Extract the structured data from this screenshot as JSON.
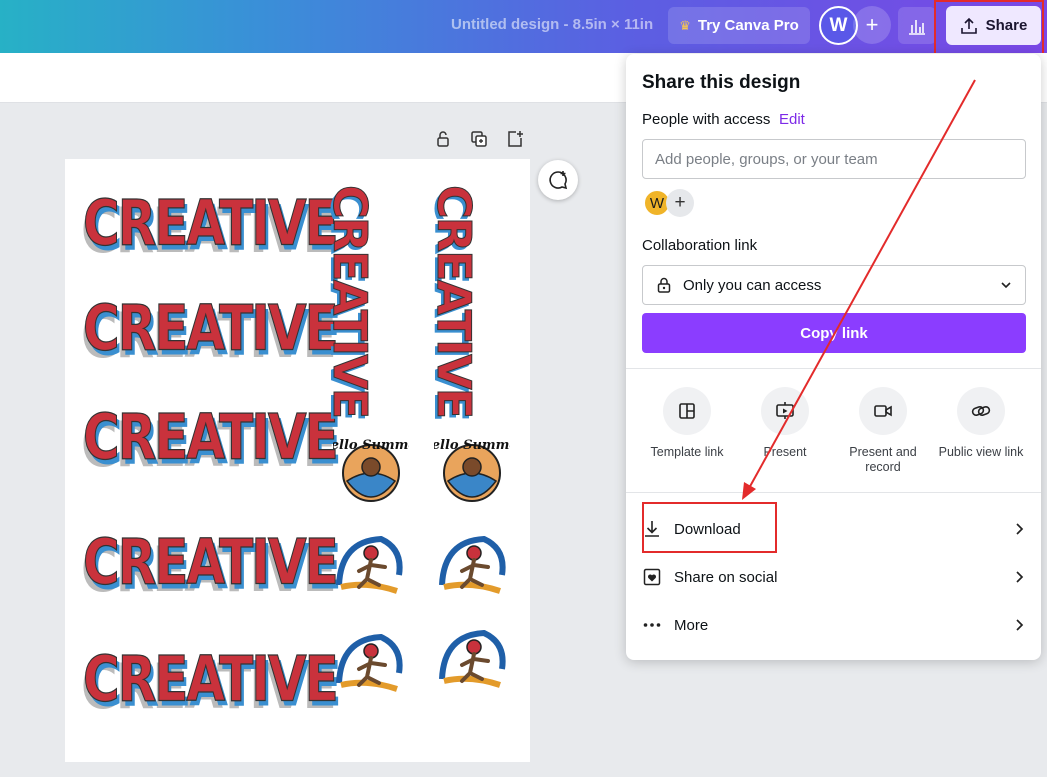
{
  "topbar": {
    "doc_title": "Untitled design - 8.5in × 11in",
    "try_pro_label": "Try Canva Pro",
    "user_initial": "W",
    "share_label": "Share"
  },
  "canvas": {
    "artwork_text": "CREATIVE",
    "sticker_text": "Hello Summer"
  },
  "share_panel": {
    "title": "Share this design",
    "people_label": "People with access",
    "edit_label": "Edit",
    "add_people_placeholder": "Add people, groups, or your team",
    "member_initial": "W",
    "collab_link_label": "Collaboration link",
    "access_value": "Only you can access",
    "copy_link_label": "Copy link",
    "options": [
      {
        "label": "Template link",
        "icon": "template-icon"
      },
      {
        "label": "Present",
        "icon": "present-icon"
      },
      {
        "label": "Present and record",
        "icon": "record-icon"
      },
      {
        "label": "Public view link",
        "icon": "link-icon"
      }
    ],
    "rows": [
      {
        "label": "Download",
        "icon": "download-icon"
      },
      {
        "label": "Share on social",
        "icon": "heart-icon"
      },
      {
        "label": "More",
        "icon": "more-icon"
      }
    ]
  },
  "colors": {
    "accent": "#8b3dff",
    "annotation": "#e32b2b"
  }
}
